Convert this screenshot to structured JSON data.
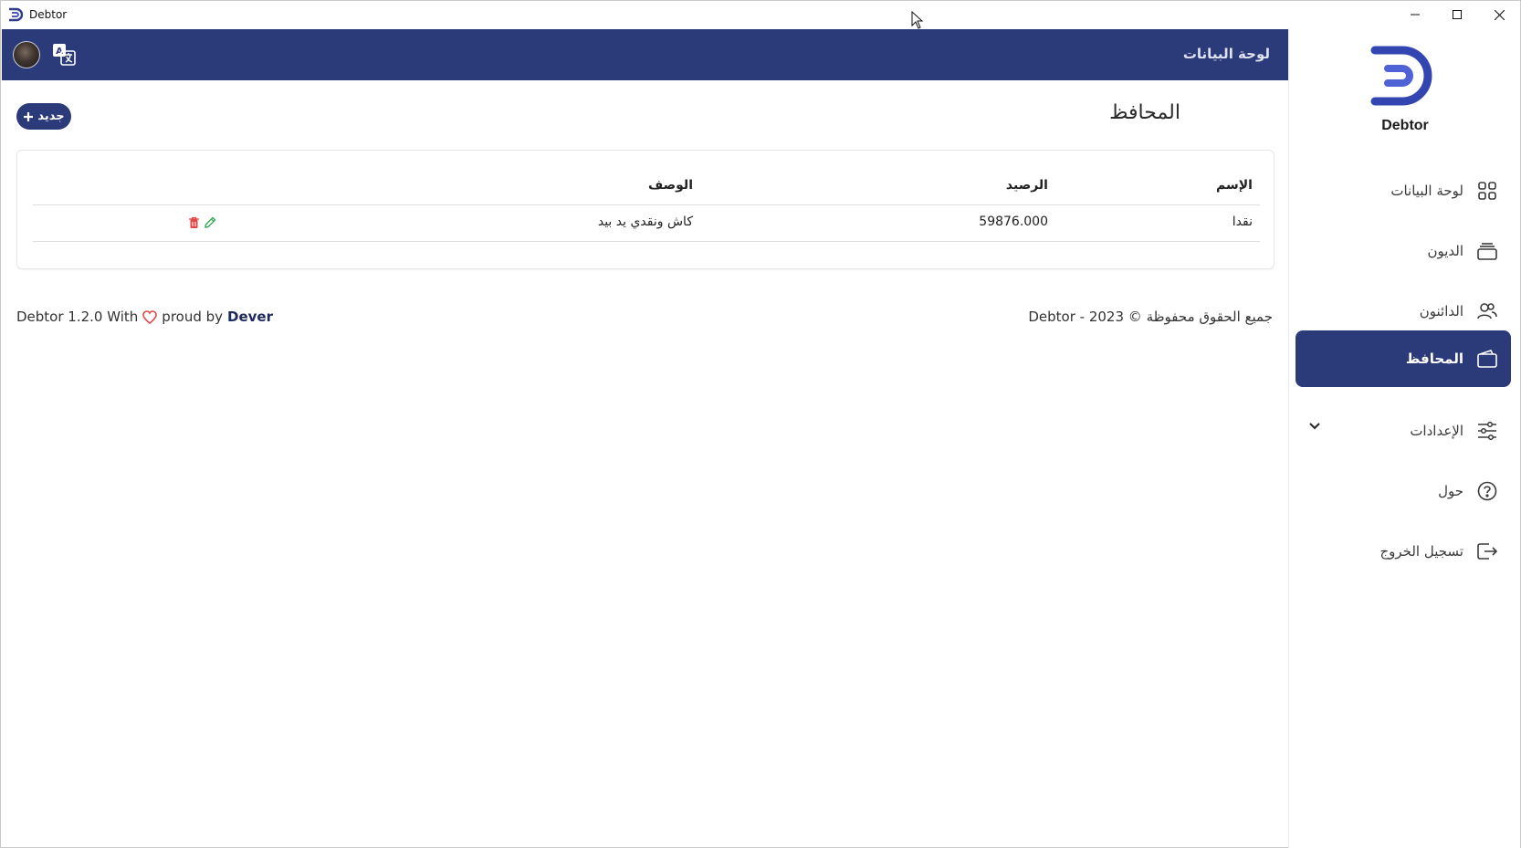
{
  "window": {
    "title": "Debtor"
  },
  "sidebar": {
    "logo_text": "Debtor",
    "items": [
      {
        "label": "لوحة البيانات",
        "icon": "grid-icon"
      },
      {
        "label": "الديون",
        "icon": "cards-stack-icon"
      },
      {
        "label": "الدائنون",
        "icon": "users-icon"
      },
      {
        "label": "المحافظ",
        "icon": "wallet-icon",
        "active": true
      },
      {
        "label": "الإعدادات",
        "icon": "sliders-icon",
        "expandable": true
      },
      {
        "label": "حول",
        "icon": "help-circle-icon"
      },
      {
        "label": "تسجيل الخروج",
        "icon": "logout-icon"
      }
    ]
  },
  "header": {
    "breadcrumb": "لوحة البيانات"
  },
  "main": {
    "title": "المحافظ",
    "new_button_label": "جديد",
    "table": {
      "columns": {
        "name": "الإسم",
        "balance": "الرصيد",
        "description": "الوصف"
      },
      "rows": [
        {
          "name": "نقدا",
          "balance": "59876.000",
          "description": "كاش ونقدي يد بيد"
        }
      ]
    }
  },
  "footer": {
    "version_text": "Debtor 1.2.0 With",
    "proud_text": "proud by",
    "brand": "Dever",
    "copyright": "جميع الحقوق محفوظة © 2023 - Debtor"
  },
  "colors": {
    "primary": "#2b3a78",
    "danger": "#e04848",
    "edit": "#3aa35a"
  }
}
